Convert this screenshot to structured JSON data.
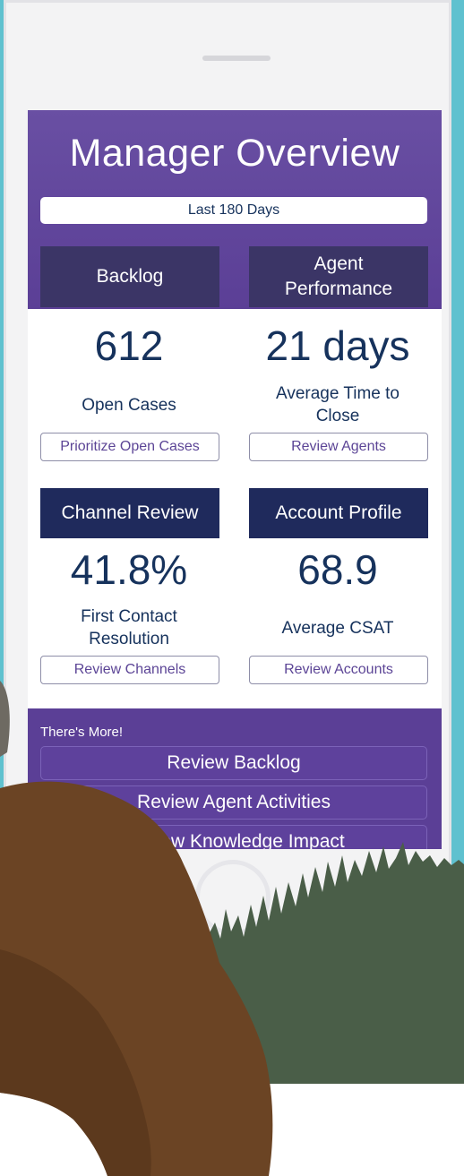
{
  "app": {
    "title": "Manager Overview",
    "date_range": "Last 180 Days"
  },
  "cards": [
    {
      "header": "Backlog",
      "metric": "612",
      "caption": "Open Cases",
      "button": "Prioritize Open Cases"
    },
    {
      "header": "Agent\nPerformance",
      "metric": "21 days",
      "caption": "Average Time to\nClose",
      "button": "Review Agents"
    },
    {
      "header": "Channel Review",
      "metric": "41.8%",
      "caption": "First Contact\nResolution",
      "button": "Review Channels"
    },
    {
      "header": "Account Profile",
      "metric": "68.9",
      "caption": "Average CSAT",
      "button": "Review Accounts"
    }
  ],
  "more": {
    "label": "There's More!",
    "items": [
      "Review Backlog",
      "Review Agent Activities",
      "Review Knowledge Impact"
    ]
  },
  "colors": {
    "background": "#5fc1cf",
    "brand_purple": "#5b3f96",
    "navy": "#1f2a5c",
    "text": "#16325c",
    "forest": "#4a5e48",
    "bear": "#6b4424"
  }
}
